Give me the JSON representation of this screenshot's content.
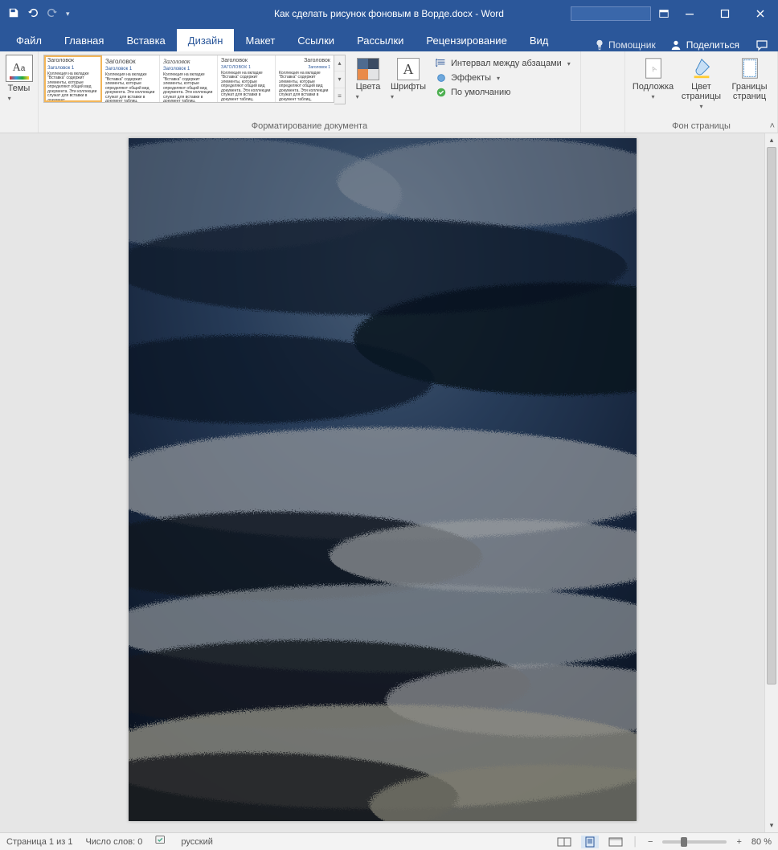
{
  "titlebar": {
    "title_full": "Как сделать рисунок фоновым в Ворде.docx  -  Word"
  },
  "tabs": {
    "file": "Файл",
    "home": "Главная",
    "insert": "Вставка",
    "design": "Дизайн",
    "layout": "Макет",
    "references": "Ссылки",
    "mailings": "Рассылки",
    "review": "Рецензирование",
    "view": "Вид",
    "help_placeholder": "Помощник",
    "share": "Поделиться"
  },
  "ribbon": {
    "themes": "Темы",
    "doc_formatting_label": "Форматирование документа",
    "style_head": "Заголовок",
    "style_sub": "Заголовок 1",
    "colors": "Цвета",
    "fonts": "Шрифты",
    "paragraph_spacing": "Интервал между абзацами",
    "effects": "Эффекты",
    "set_default": "По умолчанию",
    "watermark": "Подложка",
    "page_color": "Цвет страницы",
    "page_borders": "Границы страниц",
    "page_bg_label": "Фон страницы"
  },
  "status": {
    "page": "Страница 1 из 1",
    "words": "Число слов: 0",
    "lang": "русский",
    "zoom": "80 %"
  }
}
